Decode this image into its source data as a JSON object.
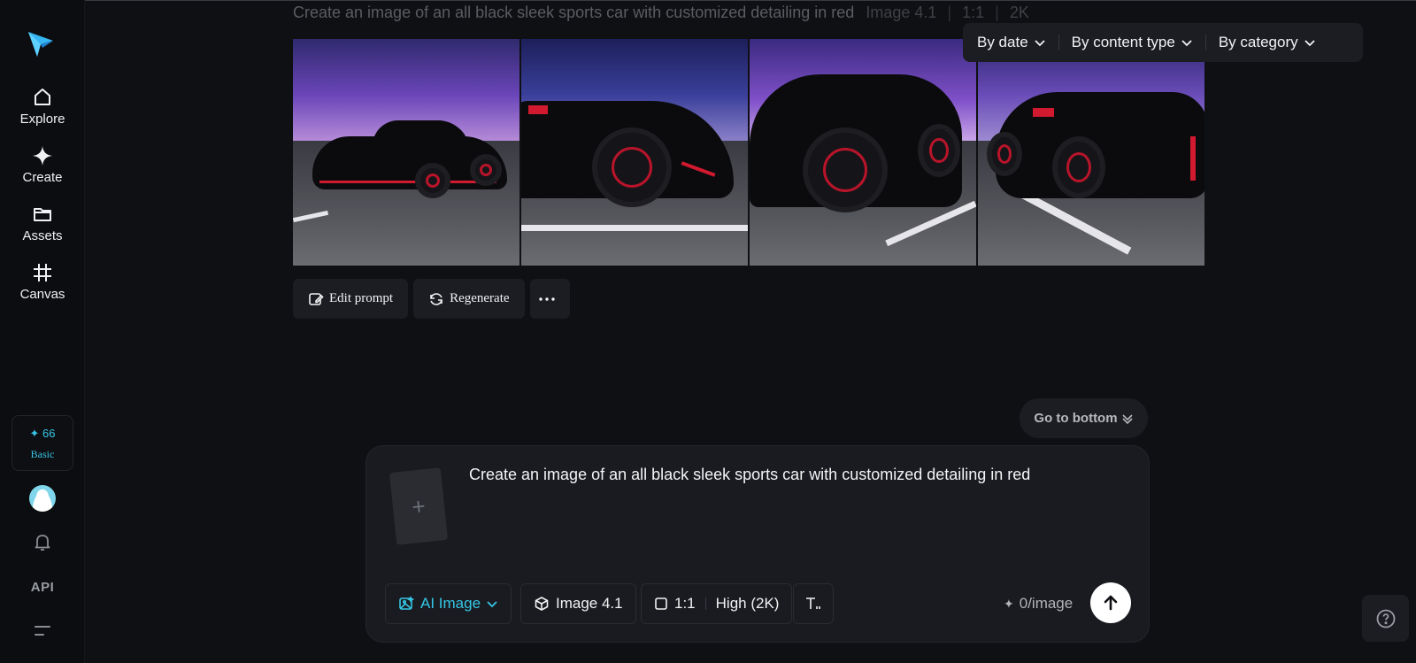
{
  "sidebar": {
    "logo_icon": "paper-plane-star-logo",
    "nav": [
      {
        "label": "Explore",
        "icon": "home-icon"
      },
      {
        "label": "Create",
        "icon": "sparkle-icon"
      },
      {
        "label": "Assets",
        "icon": "folder-icon"
      },
      {
        "label": "Canvas",
        "icon": "frame-icon"
      }
    ],
    "credits": {
      "count": "✦ 66",
      "tier": "Basic"
    },
    "api_label": "API"
  },
  "history": {
    "prompt": "Create an image of an all black sleek sports car with customized detailing in red",
    "model": "Image 4.1",
    "ratio": "1:1",
    "quality": "2K",
    "images": [
      {
        "alt": "black sports car on road at dusk, front three-quarter view"
      },
      {
        "alt": "black sports car side close-up with red brake caliper"
      },
      {
        "alt": "black sedan low angle with red wheels"
      },
      {
        "alt": "black coupe front view with red accents"
      }
    ],
    "actions": {
      "edit": "Edit prompt",
      "regenerate": "Regenerate"
    }
  },
  "filters": [
    "By date",
    "By content type",
    "By category"
  ],
  "goto_bottom": "Go to bottom",
  "composer": {
    "prompt": "Create an image of an all black sleek sports car with customized detailing in red",
    "mode": "AI Image",
    "model": "Image 4.1",
    "ratio": "1:1",
    "quality": "High (2K)",
    "cost": "0/image"
  },
  "colors": {
    "accent": "#35c7e6",
    "background": "#0f1013",
    "panel": "#1a1b20"
  }
}
